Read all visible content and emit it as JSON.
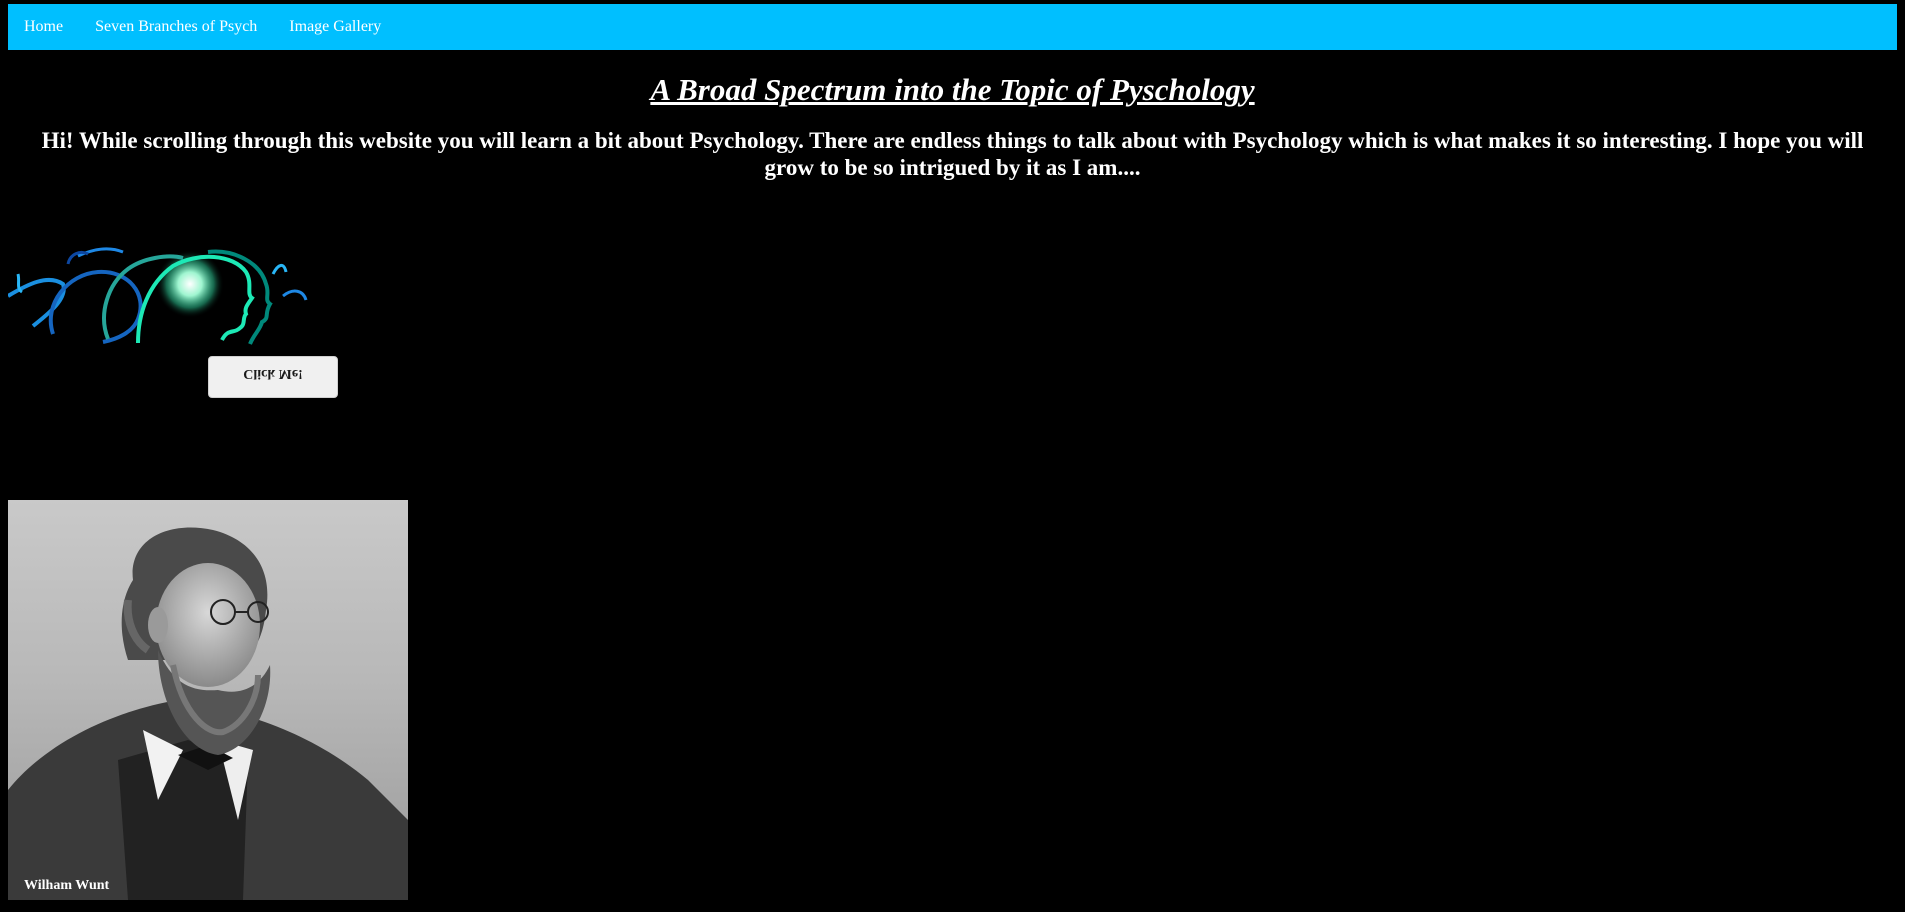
{
  "nav": {
    "items": [
      {
        "label": "Home"
      },
      {
        "label": "Seven Branches of Psych"
      },
      {
        "label": "Image Gallery"
      }
    ],
    "bg_color": "#00bfff"
  },
  "main": {
    "title": "A Broad Spectrum into the Topic of Pyschology",
    "intro": "Hi! While scrolling through this website you will learn a bit about Psychology. There are endless things to talk about with Psychology which is what makes it so interesting. I hope you will grow to be so intrigued by it as I am....",
    "button_label": "Click Me!",
    "portrait_caption": "Wilham Wunt"
  },
  "colors": {
    "page_bg": "#000000",
    "text": "#ffffff"
  }
}
